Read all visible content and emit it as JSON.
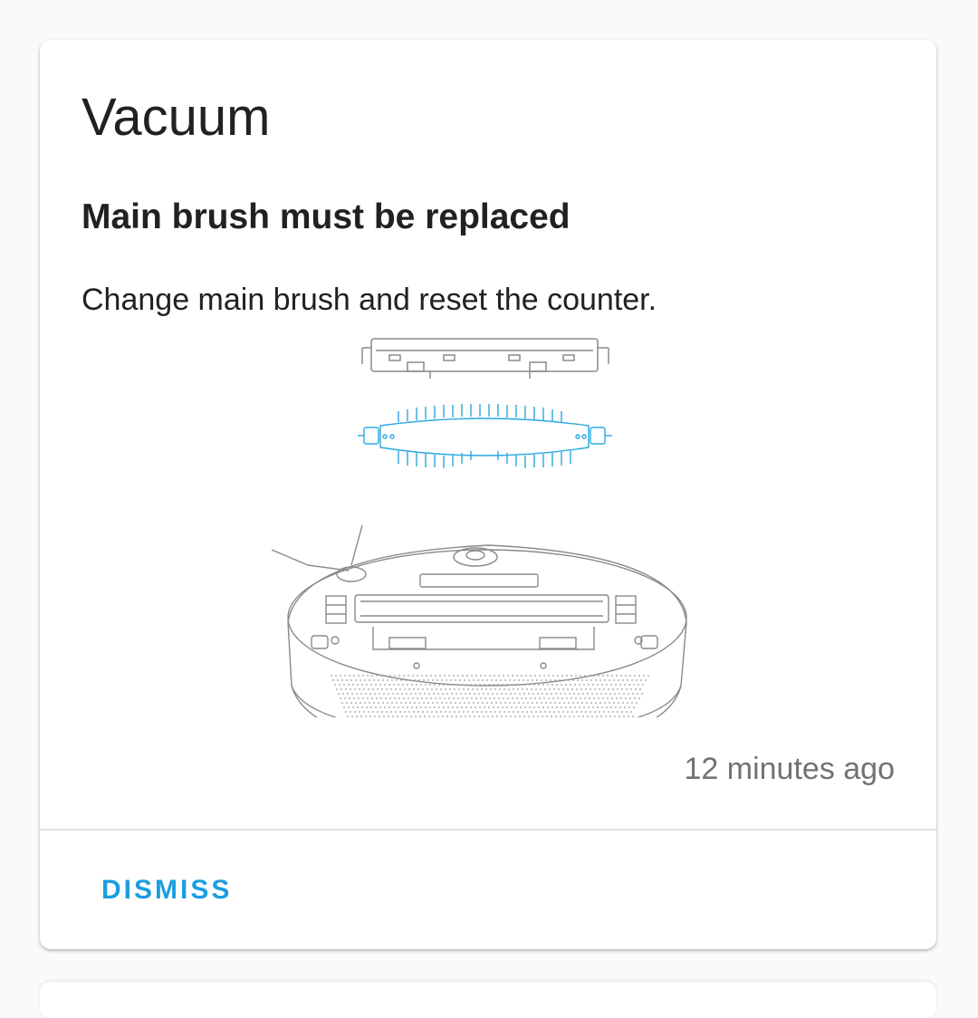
{
  "notification": {
    "title": "Vacuum",
    "subtitle": "Main brush must be replaced",
    "message": "Change main brush and reset the counter.",
    "timestamp": "12 minutes ago",
    "illustration_icon": "robot-vacuum-main-brush-illustration"
  },
  "actions": {
    "dismiss_label": "DISMISS"
  },
  "colors": {
    "accent": "#1b9ee0",
    "brush": "#29a8e0",
    "line": "#8a8a8a"
  }
}
